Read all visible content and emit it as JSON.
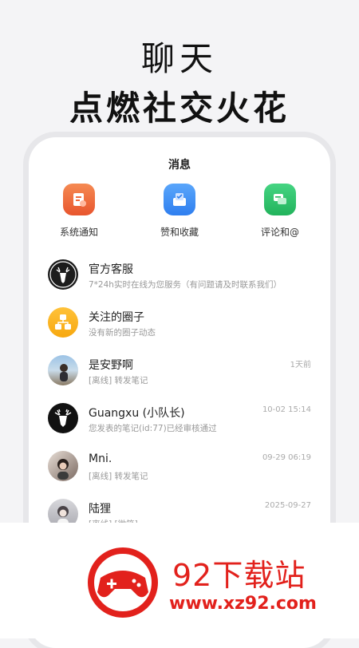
{
  "hero": {
    "title": "聊天",
    "subtitle": "点燃社交火花"
  },
  "screen": {
    "title": "消息",
    "quick_actions": [
      {
        "label": "系统通知",
        "icon": "notice-icon",
        "color": "#ef6a3c"
      },
      {
        "label": "赞和收藏",
        "icon": "like-collect-icon",
        "color": "#3a8ef6"
      },
      {
        "label": "评论和@",
        "icon": "comment-icon",
        "color": "#2ec26b"
      }
    ],
    "conversations": [
      {
        "name": "官方客服",
        "preview": "7*24h实时在线为您服务（有问题请及时联系我们）",
        "time": "",
        "avatar": "deer-avatar-icon"
      },
      {
        "name": "关注的圈子",
        "preview": "没有新的圈子动态",
        "time": "",
        "avatar": "circle-group-icon"
      },
      {
        "name": "是安野啊",
        "preview": "[离线] 转发笔记",
        "time": "1天前",
        "avatar": "photo-avatar"
      },
      {
        "name": "Guangxu (小队长)",
        "preview": "您发表的笔记(id:77)已经审核通过",
        "time": "10-02 15:14",
        "avatar": "deer-avatar-icon"
      },
      {
        "name": "Mni.",
        "preview": "[离线] 转发笔记",
        "time": "09-29 06:19",
        "avatar": "photo-avatar"
      },
      {
        "name": "陆狸",
        "preview": "[离线] [微笑]",
        "time": "2025-09-27",
        "avatar": "photo-avatar"
      }
    ]
  },
  "watermark": {
    "brand": "92下载站",
    "url": "www.xz92.com",
    "color": "#e2211c"
  }
}
